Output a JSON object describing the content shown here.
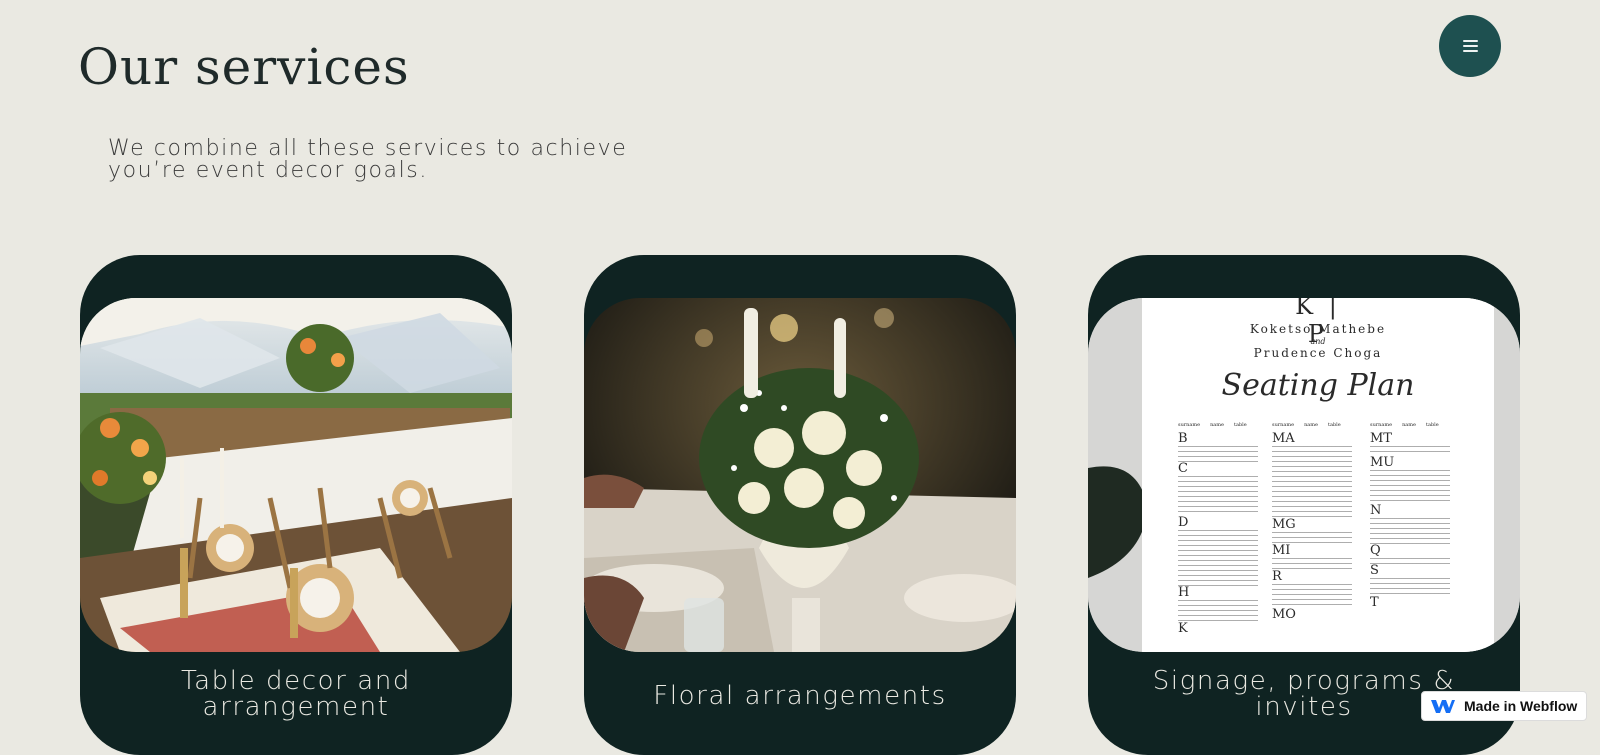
{
  "header": {
    "title": "Our services",
    "intro": "We combine all these services to achieve you’re event decor goals."
  },
  "menu": {
    "icon": "hamburger-menu-icon"
  },
  "services": [
    {
      "label": "Table decor and arrangement",
      "image": "outdoor-tent-table-setting-photo"
    },
    {
      "label": "Floral arrangements",
      "image": "white-rose-centerpiece-photo"
    },
    {
      "label": "Signage, programs & invites",
      "image": "seating-plan-sign-photo"
    }
  ],
  "seating_plan": {
    "couple_line1": "Koketso Mathebe",
    "couple_and": "and",
    "couple_line2": "Prudence Choga",
    "title": "Seating Plan",
    "column_headers": [
      "surname",
      "name",
      "table"
    ],
    "col1_letters": [
      "B",
      "C",
      "D",
      "H",
      "K"
    ],
    "col2_letters": [
      "MA",
      "MG",
      "MI",
      "R",
      "MO"
    ],
    "col3_letters": [
      "MT",
      "MU",
      "N",
      "Q",
      "S",
      "T"
    ]
  },
  "badge": {
    "label": "Made in Webflow",
    "icon": "webflow-logo-icon"
  },
  "colors": {
    "background": "#eae9e2",
    "card": "#0f2322",
    "menu_button": "#1e5050",
    "badge_brand": "#146ef5"
  }
}
